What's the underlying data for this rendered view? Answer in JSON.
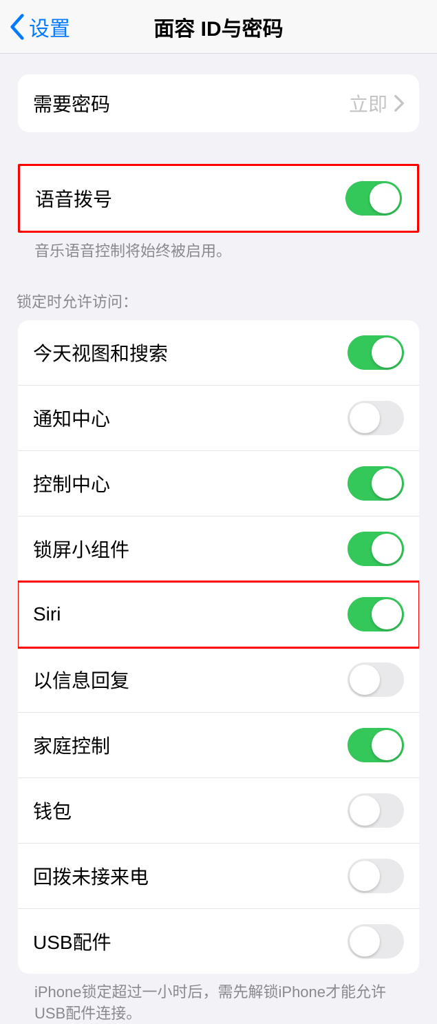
{
  "header": {
    "back_label": "设置",
    "title": "面容 ID与密码"
  },
  "passcode_group": {
    "require_passcode_label": "需要密码",
    "require_passcode_value": "立即"
  },
  "voice_dial_group": {
    "label": "语音拨号",
    "footer": "音乐语音控制将始终被启用。"
  },
  "locked_access": {
    "header": "锁定时允许访问：",
    "items": [
      {
        "label": "今天视图和搜索",
        "on": true
      },
      {
        "label": "通知中心",
        "on": false
      },
      {
        "label": "控制中心",
        "on": true
      },
      {
        "label": "锁屏小组件",
        "on": true
      },
      {
        "label": "Siri",
        "on": true
      },
      {
        "label": "以信息回复",
        "on": false
      },
      {
        "label": "家庭控制",
        "on": true
      },
      {
        "label": "钱包",
        "on": false
      },
      {
        "label": "回拨未接来电",
        "on": false
      },
      {
        "label": "USB配件",
        "on": false
      }
    ],
    "footer": "iPhone锁定超过一小时后，需先解锁iPhone才能允许USB配件连接。"
  }
}
